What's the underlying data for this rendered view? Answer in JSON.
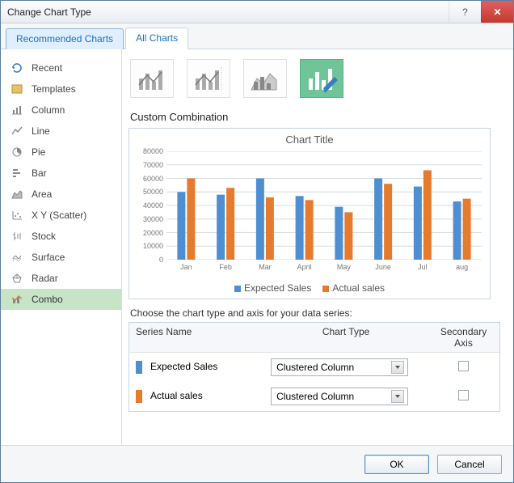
{
  "window": {
    "title": "Change Chart Type"
  },
  "tabs": {
    "recommended": "Recommended Charts",
    "all": "All Charts"
  },
  "sidebar": {
    "items": [
      {
        "label": "Recent"
      },
      {
        "label": "Templates"
      },
      {
        "label": "Column"
      },
      {
        "label": "Line"
      },
      {
        "label": "Pie"
      },
      {
        "label": "Bar"
      },
      {
        "label": "Area"
      },
      {
        "label": "X Y (Scatter)"
      },
      {
        "label": "Stock"
      },
      {
        "label": "Surface"
      },
      {
        "label": "Radar"
      },
      {
        "label": "Combo"
      }
    ]
  },
  "main": {
    "section_title": "Custom Combination",
    "preview_title": "Chart Title",
    "legend": {
      "s1": "Expected Sales",
      "s2": "Actual sales"
    },
    "instruction": "Choose the chart type and axis for your data series:",
    "table": {
      "head": {
        "name": "Series Name",
        "type": "Chart Type",
        "axis": "Secondary Axis"
      },
      "rows": [
        {
          "name": "Expected Sales",
          "type": "Clustered Column"
        },
        {
          "name": "Actual sales",
          "type": "Clustered Column"
        }
      ]
    }
  },
  "footer": {
    "ok": "OK",
    "cancel": "Cancel"
  },
  "chart_data": {
    "type": "bar",
    "categories": [
      "Jan",
      "Feb",
      "Mar",
      "April",
      "May",
      "June",
      "Jul",
      "aug"
    ],
    "series": [
      {
        "name": "Expected Sales",
        "values": [
          50000,
          48000,
          60000,
          47000,
          39000,
          60000,
          54000,
          43000
        ]
      },
      {
        "name": "Actual sales",
        "values": [
          60000,
          53000,
          46000,
          44000,
          35000,
          56000,
          66000,
          45000
        ]
      }
    ],
    "title": "Chart Title",
    "ylabel": "",
    "xlabel": "",
    "ylim": [
      0,
      80000
    ],
    "yticks": [
      0,
      10000,
      20000,
      30000,
      40000,
      50000,
      60000,
      70000,
      80000
    ]
  }
}
